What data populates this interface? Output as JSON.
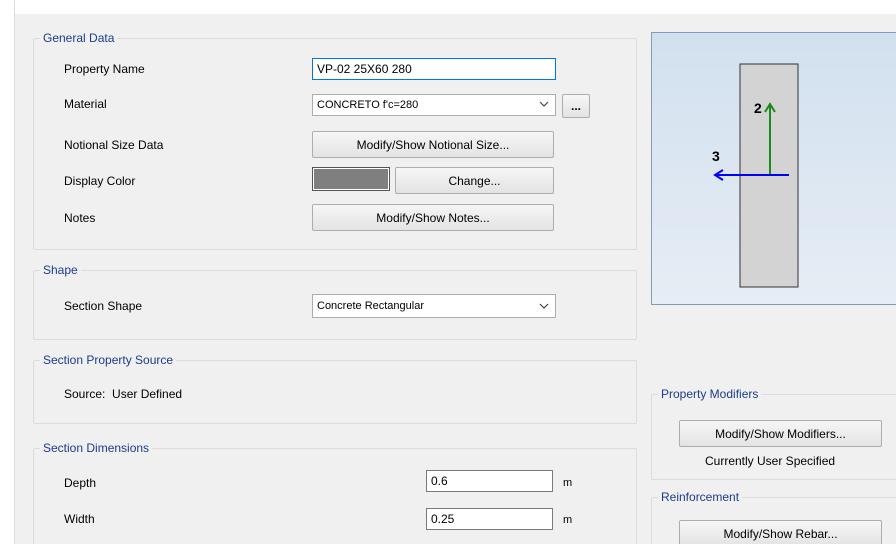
{
  "window": {
    "title": ""
  },
  "general": {
    "legend": "General Data",
    "property_name_label": "Property Name",
    "property_name_value": "VP-02 25X60 280",
    "material_label": "Material",
    "material_value": "CONCRETO f'c=280",
    "material_browse": "...",
    "notional_label": "Notional Size Data",
    "notional_button": "Modify/Show Notional Size...",
    "color_label": "Display Color",
    "color_value": "#7f7f7f",
    "color_button": "Change...",
    "notes_label": "Notes",
    "notes_button": "Modify/Show Notes..."
  },
  "shape": {
    "legend": "Shape",
    "section_shape_label": "Section Shape",
    "section_shape_value": "Concrete Rectangular"
  },
  "source": {
    "legend": "Section Property Source",
    "text": "Source:  User Defined"
  },
  "dimensions": {
    "legend": "Section Dimensions",
    "depth_label": "Depth",
    "depth_value": "0.6",
    "depth_unit": "m",
    "width_label": "Width",
    "width_value": "0.25",
    "width_unit": "m"
  },
  "preview": {
    "axis_2_label": "2",
    "axis_3_label": "3",
    "axis_2_color": "#1a8a1a",
    "axis_3_color": "#0000ff"
  },
  "modifiers": {
    "legend": "Property Modifiers",
    "button": "Modify/Show Modifiers...",
    "status": "Currently User Specified"
  },
  "reinforcement": {
    "legend": "Reinforcement",
    "button": "Modify/Show Rebar..."
  }
}
